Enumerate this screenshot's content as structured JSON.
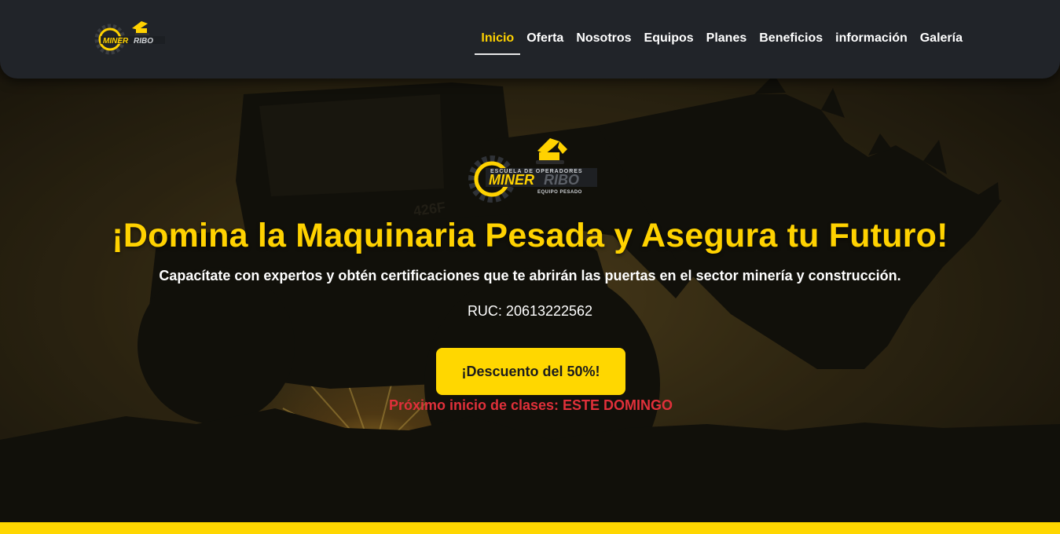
{
  "brand": {
    "logo_main": "MINER",
    "logo_accent": "RIBO",
    "logo_top": "ESCUELA DE OPERADORES",
    "logo_bottom": "EQUIPO PESADO",
    "logo_icon": "excavator-gear-icon",
    "colors": {
      "accent": "#ffd200",
      "nav_bg": "#212429",
      "alert": "#e0303a"
    }
  },
  "nav": {
    "items": [
      {
        "label": "Inicio",
        "active": true
      },
      {
        "label": "Oferta"
      },
      {
        "label": "Nosotros"
      },
      {
        "label": "Equipos"
      },
      {
        "label": "Planes"
      },
      {
        "label": "Beneficios"
      },
      {
        "label": "información"
      },
      {
        "label": "Galería"
      }
    ]
  },
  "hero": {
    "background_image": "loader-silhouette-sunset",
    "machine_label": "426F",
    "title": "¡Domina la Maquinaria Pesada y Asegura tu Futuro!",
    "subtitle": "Capacítate con expertos y obtén certificaciones que te abrirán las puertas en el sector minería y construcción.",
    "ruc": "RUC: 20613222562",
    "cta_label": "¡Descuento del 50%!",
    "next_class": "Próximo inicio de clases: ESTE DOMINGO"
  }
}
